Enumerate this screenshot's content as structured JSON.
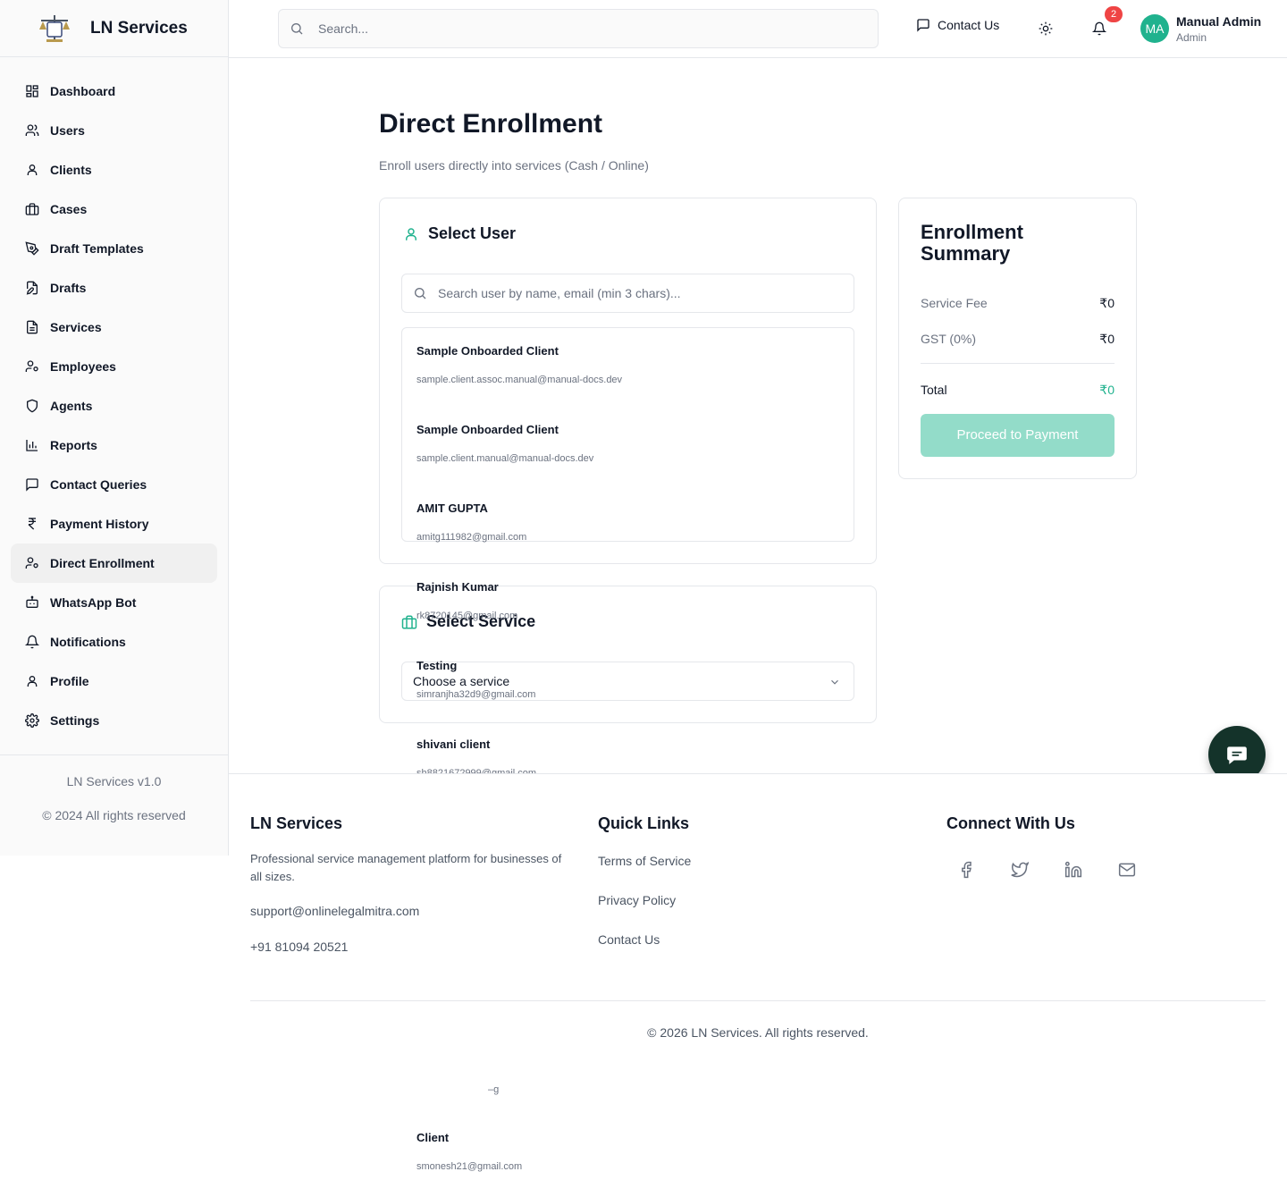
{
  "brand": {
    "name": "LN Services",
    "logo_icon": "scales-of-justice-logo"
  },
  "sidebar": {
    "items": [
      {
        "label": "Dashboard",
        "icon": "grid-icon"
      },
      {
        "label": "Users",
        "icon": "users-icon"
      },
      {
        "label": "Clients",
        "icon": "user-icon"
      },
      {
        "label": "Cases",
        "icon": "briefcase-icon"
      },
      {
        "label": "Draft Templates",
        "icon": "pen-tool-icon"
      },
      {
        "label": "Drafts",
        "icon": "edit-file-icon"
      },
      {
        "label": "Services",
        "icon": "file-text-icon"
      },
      {
        "label": "Employees",
        "icon": "user-cog-icon"
      },
      {
        "label": "Agents",
        "icon": "shield-icon"
      },
      {
        "label": "Reports",
        "icon": "bar-chart-icon"
      },
      {
        "label": "Contact Queries",
        "icon": "message-square-icon"
      },
      {
        "label": "Payment History",
        "icon": "rupee-icon"
      },
      {
        "label": "Direct Enrollment",
        "icon": "user-cog-icon",
        "active": true
      },
      {
        "label": "WhatsApp Bot",
        "icon": "bot-icon"
      },
      {
        "label": "Notifications",
        "icon": "bell-icon"
      },
      {
        "label": "Profile",
        "icon": "user-icon"
      },
      {
        "label": "Settings",
        "icon": "gear-icon"
      }
    ],
    "version": "LN Services v1.0",
    "copyright": "© 2024 All rights reserved"
  },
  "header": {
    "search_placeholder": "Search...",
    "contact_label": "Contact Us",
    "notification_count": "2",
    "avatar_initials": "MA",
    "user_name": "Manual Admin",
    "user_role": "Admin"
  },
  "main": {
    "title": "Direct Enrollment",
    "subtitle": "Enroll users directly into services (Cash / Online)",
    "select_user": {
      "heading": "Select User",
      "search_placeholder": "Search user by name, email (min 3 chars)...",
      "users": [
        {
          "name": "Sample Onboarded Client",
          "email": "sample.client.assoc.manual@manual-docs.dev"
        },
        {
          "name": "Sample Onboarded Client",
          "email": "sample.client.manual@manual-docs.dev"
        },
        {
          "name": "AMIT GUPTA",
          "email": "amitg111982@gmail.com"
        },
        {
          "name": "Rajnish Kumar",
          "email": "rk8720145@gmail.com"
        },
        {
          "name": "Testing",
          "email": "simranjha32d9@gmail.com"
        },
        {
          "name": "shivani client",
          "email": "sh8821672999@gmail.com"
        },
        {
          "name": "Client",
          "email": "smonesh21@gmail.com"
        }
      ],
      "partial_email_fragment": "–g"
    },
    "select_service": {
      "heading": "Select Service",
      "placeholder": "Choose a service"
    },
    "summary": {
      "title": "Enrollment Summary",
      "service_fee_label": "Service Fee",
      "service_fee_value": "₹0",
      "gst_label": "GST (0%)",
      "gst_value": "₹0",
      "total_label": "Total",
      "total_value": "₹0",
      "pay_button": "Proceed to Payment"
    }
  },
  "footer": {
    "brand_title": "LN Services",
    "description": "Professional service management platform for businesses of all sizes.",
    "email": "support@onlinelegalmitra.com",
    "phone": "+91 81094 20521",
    "quick_links_title": "Quick Links",
    "links": [
      "Terms of Service",
      "Privacy Policy",
      "Contact Us"
    ],
    "connect_title": "Connect With Us",
    "social_icons": [
      "facebook-icon",
      "twitter-icon",
      "linkedin-icon",
      "mail-icon"
    ],
    "copyright": "© 2026 LN Services. All rights reserved."
  },
  "colors": {
    "accent": "#20b28e",
    "accent_light": "#93dcc9",
    "chat_button": "#14332a",
    "badge": "#ef4444"
  }
}
